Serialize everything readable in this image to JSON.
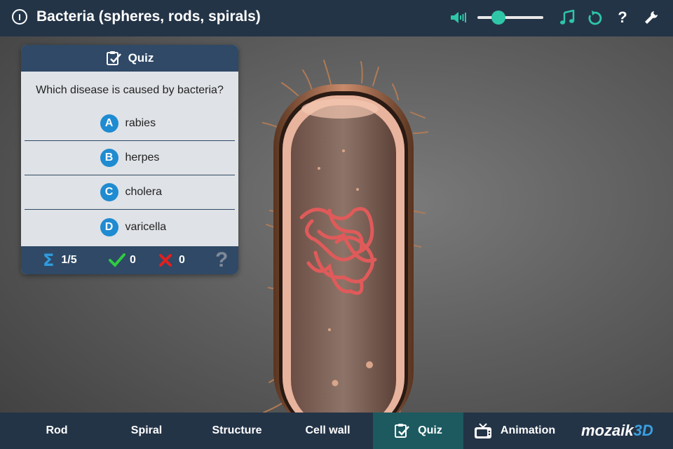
{
  "app": {
    "title": "Bacteria (spheres, rods, spirals)"
  },
  "header_icons": {
    "volume": "speaker-icon",
    "music": "music-note-icon",
    "reset": "reset-icon",
    "help": "?",
    "settings": "wrench-icon",
    "accent": "#2fc6a8",
    "volume_level_percent": 32
  },
  "quiz": {
    "heading": "Quiz",
    "question": "Which disease is caused by bacteria?",
    "answers": [
      {
        "letter": "A",
        "text": "rabies"
      },
      {
        "letter": "B",
        "text": "herpes"
      },
      {
        "letter": "C",
        "text": "cholera"
      },
      {
        "letter": "D",
        "text": "varicella"
      }
    ],
    "progress": "1/5",
    "correct": "0",
    "wrong": "0",
    "help": "?"
  },
  "tabs": [
    {
      "label": "Rod"
    },
    {
      "label": "Spiral"
    },
    {
      "label": "Structure"
    },
    {
      "label": "Cell wall"
    },
    {
      "label": "Quiz",
      "active": true
    },
    {
      "label": "Animation"
    }
  ],
  "logo": {
    "main": "mozaik",
    "accent": "3D"
  },
  "colors": {
    "header_bg": "#243447",
    "panel_head": "#2f4966",
    "active_tab": "#1c5a60",
    "letter_badge": "#1f8bd1",
    "correct": "#2ecc40",
    "wrong": "#e02020"
  }
}
